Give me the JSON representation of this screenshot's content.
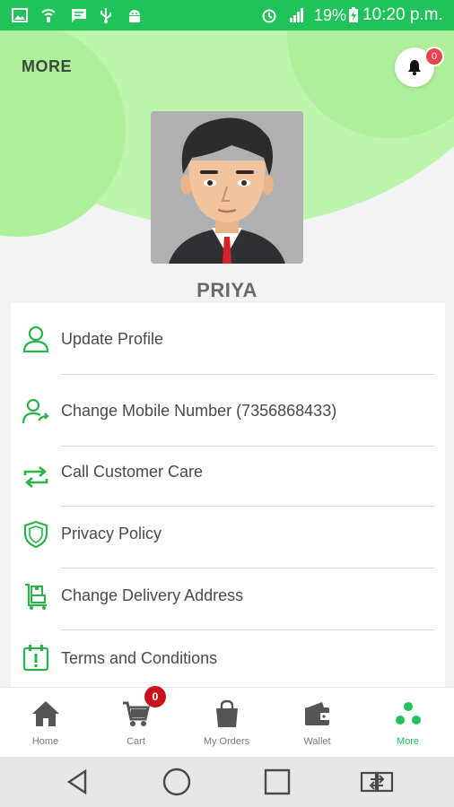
{
  "status_bar": {
    "battery_percent": "19%",
    "time": "10:20 p.m.",
    "icons": [
      "image-icon",
      "wifi-calling-icon",
      "message-icon",
      "usb-icon",
      "android-icon",
      "alarm-icon",
      "signal-icon",
      "battery-charging-icon"
    ]
  },
  "header": {
    "title": "MORE",
    "notification_count": "0"
  },
  "profile": {
    "name": "PRIYA"
  },
  "menu": {
    "items": [
      {
        "label": "Update Profile",
        "icon": "user-icon"
      },
      {
        "label": "Change Mobile Number (7356868433)",
        "icon": "user-share-icon"
      },
      {
        "label": "Call Customer Care",
        "icon": "swap-arrows-icon"
      },
      {
        "label": "Privacy Policy",
        "icon": "shield-icon"
      },
      {
        "label": "Change Delivery Address",
        "icon": "delivery-trolley-icon"
      },
      {
        "label": "Terms and Conditions",
        "icon": "calendar-alert-icon"
      }
    ]
  },
  "bottom_nav": {
    "items": [
      {
        "label": "Home",
        "icon": "home-icon"
      },
      {
        "label": "Cart",
        "icon": "cart-icon"
      },
      {
        "label": "My Orders",
        "icon": "shopping-bag-icon"
      },
      {
        "label": "Wallet",
        "icon": "wallet-icon"
      },
      {
        "label": "More",
        "icon": "more-dots-icon"
      }
    ],
    "cart_count": "0",
    "active": "More"
  },
  "colors": {
    "brand_green": "#1fc35a",
    "header_green": "#bdf5ac",
    "icon_green": "#2bb34a",
    "badge_red": "#e8434f",
    "cart_badge_red": "#c8141f",
    "active_nav": "#1fc35a"
  }
}
